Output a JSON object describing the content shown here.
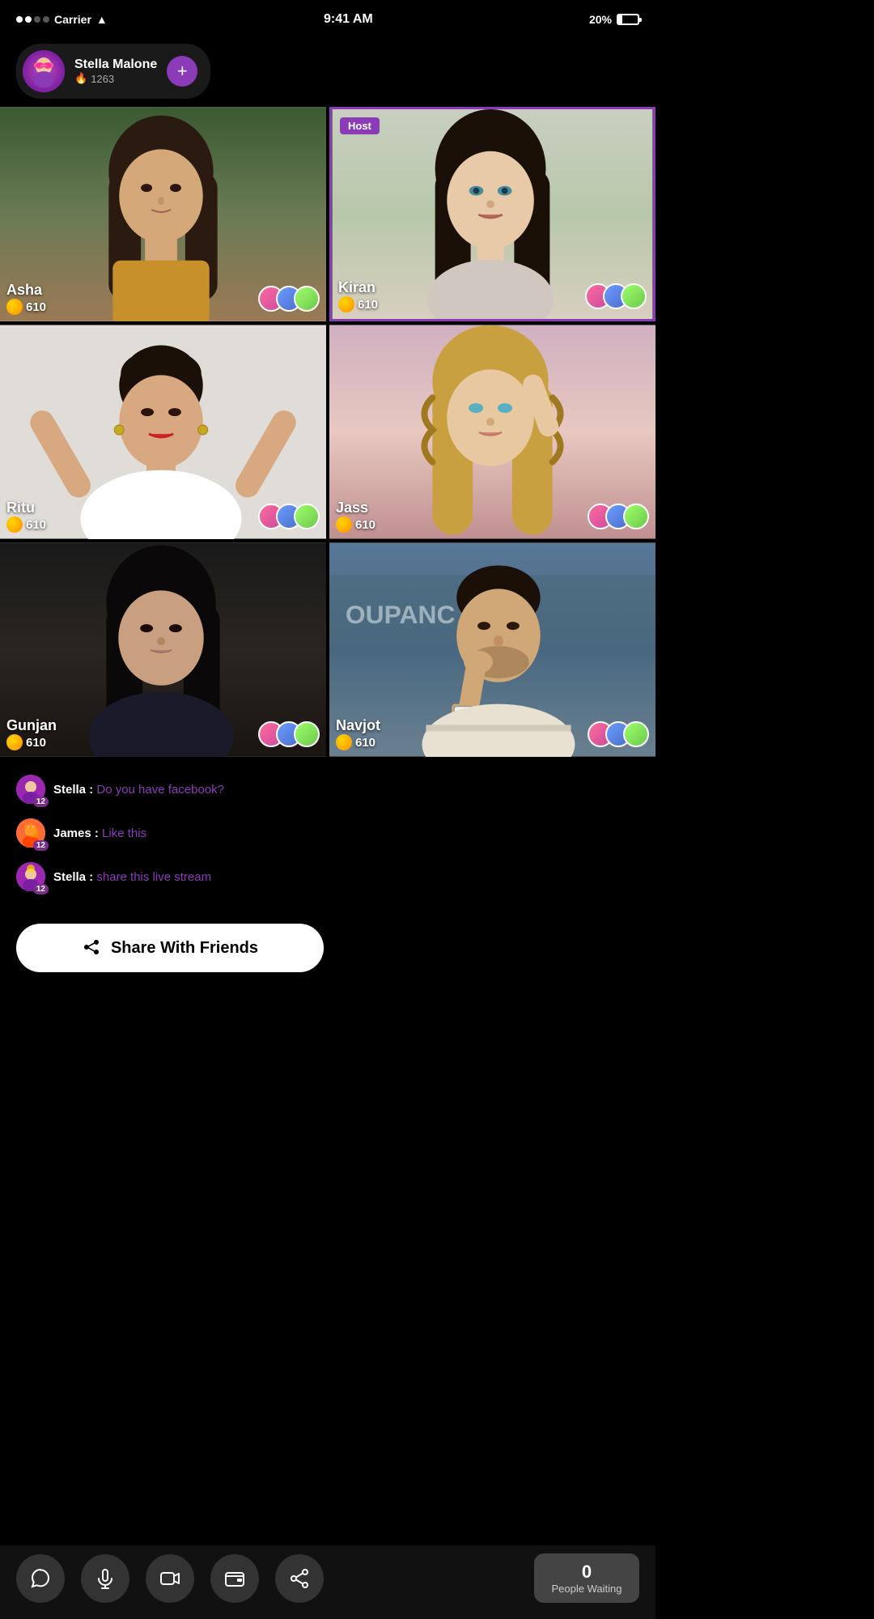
{
  "statusBar": {
    "carrier": "Carrier",
    "time": "9:41 AM",
    "battery": "20%"
  },
  "hostCard": {
    "name": "Stella Malone",
    "score": "1263",
    "fireIcon": "🔥",
    "addBtn": "+"
  },
  "grid": [
    {
      "id": "asha",
      "name": "Asha",
      "score": "610",
      "isHost": false,
      "bgClass": "bg-asha"
    },
    {
      "id": "kiran",
      "name": "Kiran",
      "score": "610",
      "isHost": true,
      "bgClass": "bg-kiran"
    },
    {
      "id": "ritu",
      "name": "Ritu",
      "score": "610",
      "isHost": false,
      "bgClass": "bg-ritu"
    },
    {
      "id": "jass",
      "name": "Jass",
      "score": "610",
      "isHost": false,
      "bgClass": "bg-jass"
    },
    {
      "id": "gunjan",
      "name": "Gunjan",
      "score": "610",
      "isHost": false,
      "bgClass": "bg-gunjan"
    },
    {
      "id": "navjot",
      "name": "Navjot",
      "score": "610",
      "isHost": false,
      "bgClass": "bg-navjot"
    }
  ],
  "hostBadgeLabel": "Host",
  "chat": {
    "messages": [
      {
        "author": "Stella",
        "content": "Do you have facebook?",
        "badge": "12",
        "avatarClass": "chat-avatar-stella"
      },
      {
        "author": "James",
        "content": "Like this",
        "badge": "12",
        "avatarClass": "chat-avatar-james"
      },
      {
        "author": "Stella",
        "content": "share this live stream",
        "badge": "12",
        "avatarClass": "chat-avatar-stella"
      }
    ]
  },
  "shareButton": {
    "label": "Share With Friends",
    "icon": "↗"
  },
  "bottomNav": {
    "buttons": [
      {
        "id": "chat",
        "icon": "💬",
        "label": "chat"
      },
      {
        "id": "mic",
        "icon": "🎙",
        "label": "microphone"
      },
      {
        "id": "video",
        "icon": "🎥",
        "label": "video"
      },
      {
        "id": "wallet",
        "icon": "👛",
        "label": "wallet"
      },
      {
        "id": "share",
        "icon": "↗",
        "label": "share"
      }
    ],
    "waitingCount": "0",
    "waitingLabel": "People Waiting"
  },
  "colors": {
    "accent": "#8B3BB8",
    "accentLight": "#E040FB",
    "coinGold": "#FFD700",
    "chatPurple": "#8B3BB8"
  }
}
